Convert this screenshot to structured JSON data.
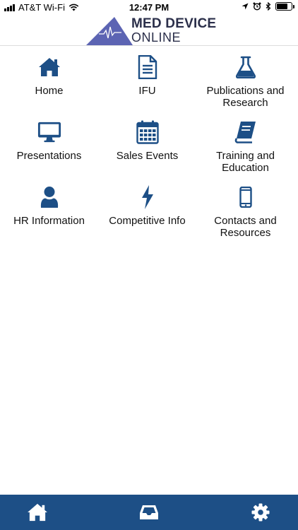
{
  "status_bar": {
    "carrier": "AT&T Wi-Fi",
    "time": "12:47 PM",
    "battery_level": 0.85
  },
  "header": {
    "logo_line1": "MED DEVICE",
    "logo_line2": "ONLINE",
    "logo_color": "#5c64b3"
  },
  "menu": {
    "items": [
      {
        "label": "Home",
        "icon": "home-icon"
      },
      {
        "label": "IFU",
        "icon": "document-icon"
      },
      {
        "label": "Publications and Research",
        "icon": "flask-icon"
      },
      {
        "label": "Presentations",
        "icon": "monitor-icon"
      },
      {
        "label": "Sales Events",
        "icon": "calendar-icon"
      },
      {
        "label": "Training and Education",
        "icon": "book-icon"
      },
      {
        "label": "HR Information",
        "icon": "user-icon"
      },
      {
        "label": "Competitive Info",
        "icon": "lightning-icon"
      },
      {
        "label": "Contacts and Resources",
        "icon": "phone-icon"
      }
    ]
  },
  "tab_bar": {
    "tabs": [
      "home-icon",
      "inbox-icon",
      "gear-icon"
    ],
    "background": "#1d4f86"
  },
  "colors": {
    "icon": "#1d4f86"
  }
}
